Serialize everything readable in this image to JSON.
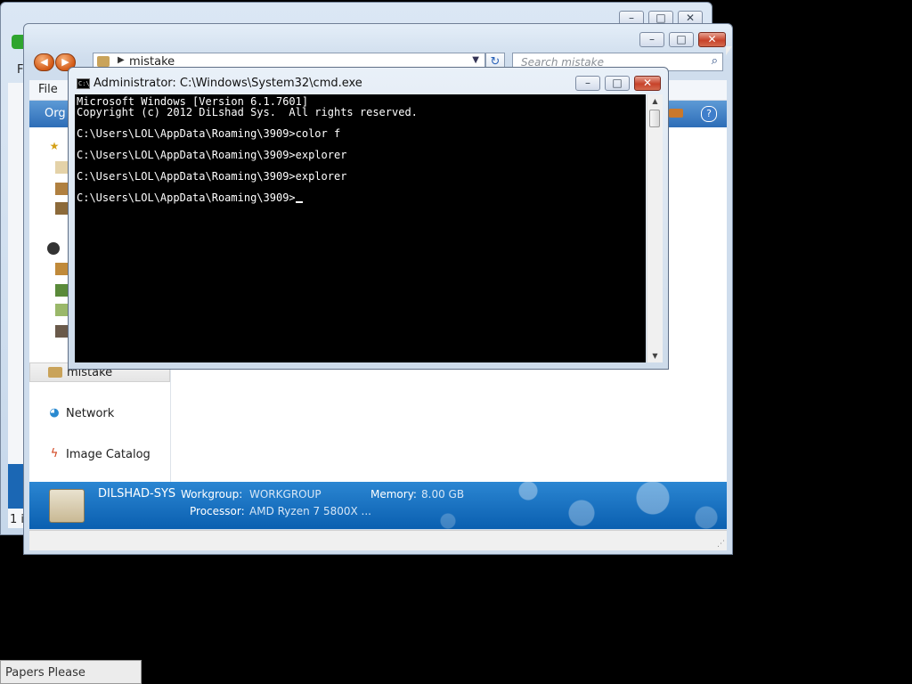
{
  "back_window": {
    "menu_first_letter": "F",
    "status_text": "1 i"
  },
  "explorer": {
    "address": {
      "text": "mistake"
    },
    "search": {
      "placeholder": "Search mistake"
    },
    "menu": {
      "file": "File"
    },
    "cmdbar": {
      "organize_partial": "Org"
    },
    "nav": {
      "mistake": "mistake",
      "network": "Network",
      "image_catalog": "Image Catalog"
    },
    "details": {
      "computer_name": "DILSHAD-SYS",
      "workgroup_label": "Workgroup:",
      "workgroup_value": "WORKGROUP",
      "memory_label": "Memory:",
      "memory_value": "8.00 GB",
      "processor_label": "Processor:",
      "processor_value": "AMD Ryzen 7 5800X ..."
    }
  },
  "cmd": {
    "title": "Administrator: C:\\Windows\\System32\\cmd.exe",
    "icon_text": "C:\\",
    "lines": [
      "Microsoft Windows [Version 6.1.7601]",
      "Copyright (c) 2012 DiLshad Sys.  All rights reserved.",
      "",
      "C:\\Users\\LOL\\AppData\\Roaming\\3909>color f",
      "",
      "C:\\Users\\LOL\\AppData\\Roaming\\3909>explorer",
      "",
      "C:\\Users\\LOL\\AppData\\Roaming\\3909>explorer",
      "",
      "C:\\Users\\LOL\\AppData\\Roaming\\3909>"
    ]
  },
  "taskbar": {
    "item_label": "Papers Please"
  },
  "colors": {
    "console_bg": "#000000",
    "console_fg": "#ffffff",
    "details_blue": "#1470c0",
    "close_red": "#c7422a"
  }
}
